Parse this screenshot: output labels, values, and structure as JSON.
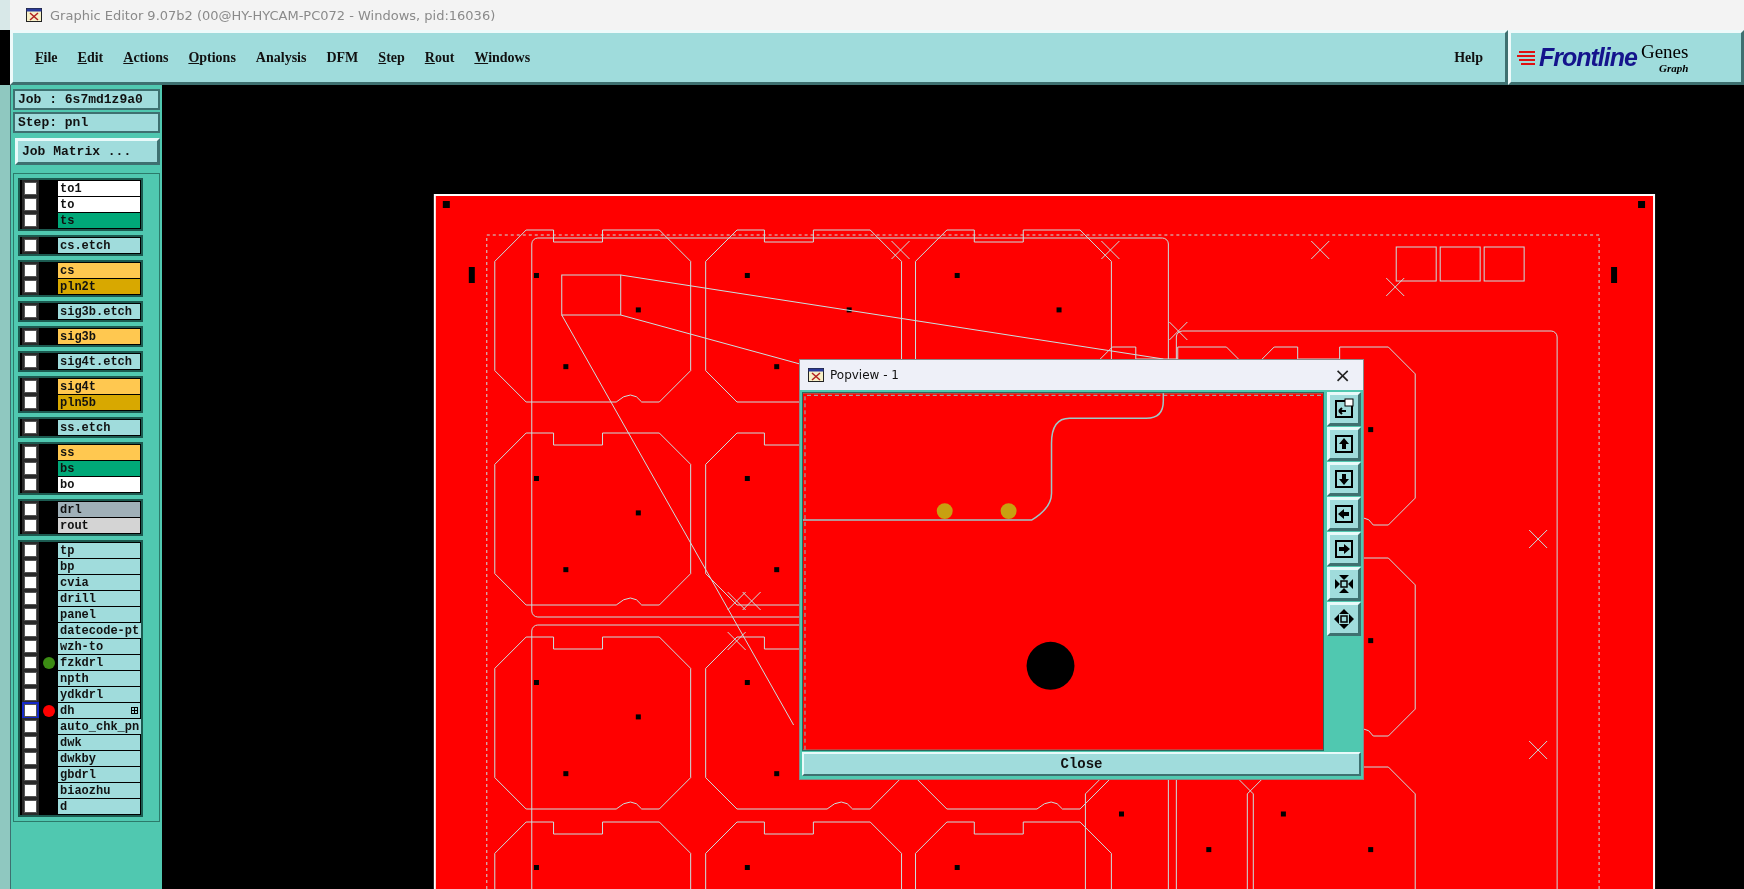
{
  "window": {
    "title": "Graphic Editor 9.07b2 (00@HY-HYCAM-PC072 - Windows, pid:16036)"
  },
  "menu": [
    {
      "label": "File",
      "mnemonic": true
    },
    {
      "label": "Edit",
      "mnemonic": true
    },
    {
      "label": "Actions",
      "mnemonic": true
    },
    {
      "label": "Options",
      "mnemonic": true
    },
    {
      "label": "Analysis",
      "mnemonic": false
    },
    {
      "label": "DFM",
      "mnemonic": false
    },
    {
      "label": "Step",
      "mnemonic": true
    },
    {
      "label": "Rout",
      "mnemonic": true
    },
    {
      "label": "Windows",
      "mnemonic": true
    }
  ],
  "help": "Help",
  "logo": {
    "brand": "Frontline",
    "product": "Genes",
    "tagline": "Graph"
  },
  "job": {
    "job_label": "Job : 6s7md1z9a0",
    "step_label": "Step: pnl",
    "matrix_button": "Job Matrix ..."
  },
  "layer_groups": [
    {
      "layers": [
        {
          "name": "to1",
          "color": "#ffffff",
          "checked": false,
          "selected": false
        },
        {
          "name": "to",
          "color": "#ffffff",
          "checked": false,
          "selected": false
        },
        {
          "name": "ts",
          "color": "#00a878",
          "checked": false,
          "selected": false
        }
      ]
    },
    {
      "layers": [
        {
          "name": "cs.etch",
          "color": "#a0dcdc",
          "checked": false,
          "selected": false
        }
      ]
    },
    {
      "layers": [
        {
          "name": "cs",
          "color": "#ffc850",
          "checked": false,
          "selected": false
        },
        {
          "name": "pln2t",
          "color": "#d8a800",
          "checked": false,
          "selected": false
        }
      ]
    },
    {
      "layers": [
        {
          "name": "sig3b.etch",
          "color": "#a0dcdc",
          "checked": false,
          "selected": false
        }
      ]
    },
    {
      "layers": [
        {
          "name": "sig3b",
          "color": "#ffc850",
          "checked": false,
          "selected": false
        }
      ]
    },
    {
      "layers": [
        {
          "name": "sig4t.etch",
          "color": "#a0dcdc",
          "checked": false,
          "selected": false
        }
      ]
    },
    {
      "layers": [
        {
          "name": "sig4t",
          "color": "#ffc850",
          "checked": false,
          "selected": false
        },
        {
          "name": "pln5b",
          "color": "#d8a800",
          "checked": false,
          "selected": false
        }
      ]
    },
    {
      "layers": [
        {
          "name": "ss.etch",
          "color": "#a0dcdc",
          "checked": false,
          "selected": false
        }
      ]
    },
    {
      "layers": [
        {
          "name": "ss",
          "color": "#ffc850",
          "checked": false,
          "selected": false
        },
        {
          "name": "bs",
          "color": "#00a878",
          "checked": false,
          "selected": false
        },
        {
          "name": "bo",
          "color": "#ffffff",
          "checked": false,
          "selected": false
        }
      ]
    },
    {
      "layers": [
        {
          "name": "drl",
          "color": "#a0b0b8",
          "checked": false,
          "selected": false
        },
        {
          "name": "rout",
          "color": "#d4d4d4",
          "checked": false,
          "selected": false
        }
      ]
    },
    {
      "layers": [
        {
          "name": "tp",
          "color": "#a0dcdc",
          "checked": false,
          "selected": false
        },
        {
          "name": "bp",
          "color": "#a0dcdc",
          "checked": false,
          "selected": false
        },
        {
          "name": "cvia",
          "color": "#a0dcdc",
          "checked": false,
          "selected": false
        },
        {
          "name": "drill",
          "color": "#a0dcdc",
          "checked": false,
          "selected": false
        },
        {
          "name": "panel",
          "color": "#a0dcdc",
          "checked": false,
          "selected": false
        },
        {
          "name": "datecode-pt",
          "color": "#a0dcdc",
          "checked": false,
          "selected": false
        },
        {
          "name": "wzh-to",
          "color": "#a0dcdc",
          "checked": false,
          "selected": false
        },
        {
          "name": "fzkdrl",
          "color": "#a0dcdc",
          "checked": false,
          "selected": false,
          "dot": {
            "color": "#3c8c14"
          }
        },
        {
          "name": "npth",
          "color": "#a0dcdc",
          "checked": false,
          "selected": false
        },
        {
          "name": "ydkdrl",
          "color": "#a0dcdc",
          "checked": false,
          "selected": false
        },
        {
          "name": "dh",
          "color": "#a0dcdc",
          "checked": false,
          "selected": true,
          "dot": {
            "color": "#ff0000"
          },
          "attached": true
        },
        {
          "name": "auto_chk_pn",
          "color": "#a0dcdc",
          "checked": false,
          "selected": false
        },
        {
          "name": "dwk",
          "color": "#a0dcdc",
          "checked": false,
          "selected": false
        },
        {
          "name": "dwkby",
          "color": "#a0dcdc",
          "checked": false,
          "selected": false
        },
        {
          "name": "gbdrl",
          "color": "#a0dcdc",
          "checked": false,
          "selected": false
        },
        {
          "name": "biaozhu",
          "color": "#a0dcdc",
          "checked": false,
          "selected": false
        },
        {
          "name": "d",
          "color": "#a0dcdc",
          "checked": false,
          "selected": false
        }
      ]
    }
  ],
  "popview": {
    "title": "Popview - 1",
    "close_x": "×",
    "tools": [
      {
        "kind": "window"
      },
      {
        "kind": "up"
      },
      {
        "kind": "down"
      },
      {
        "kind": "left"
      },
      {
        "kind": "right"
      },
      {
        "kind": "zoom_in"
      },
      {
        "kind": "zoom_out"
      }
    ],
    "close_button": "Close"
  }
}
